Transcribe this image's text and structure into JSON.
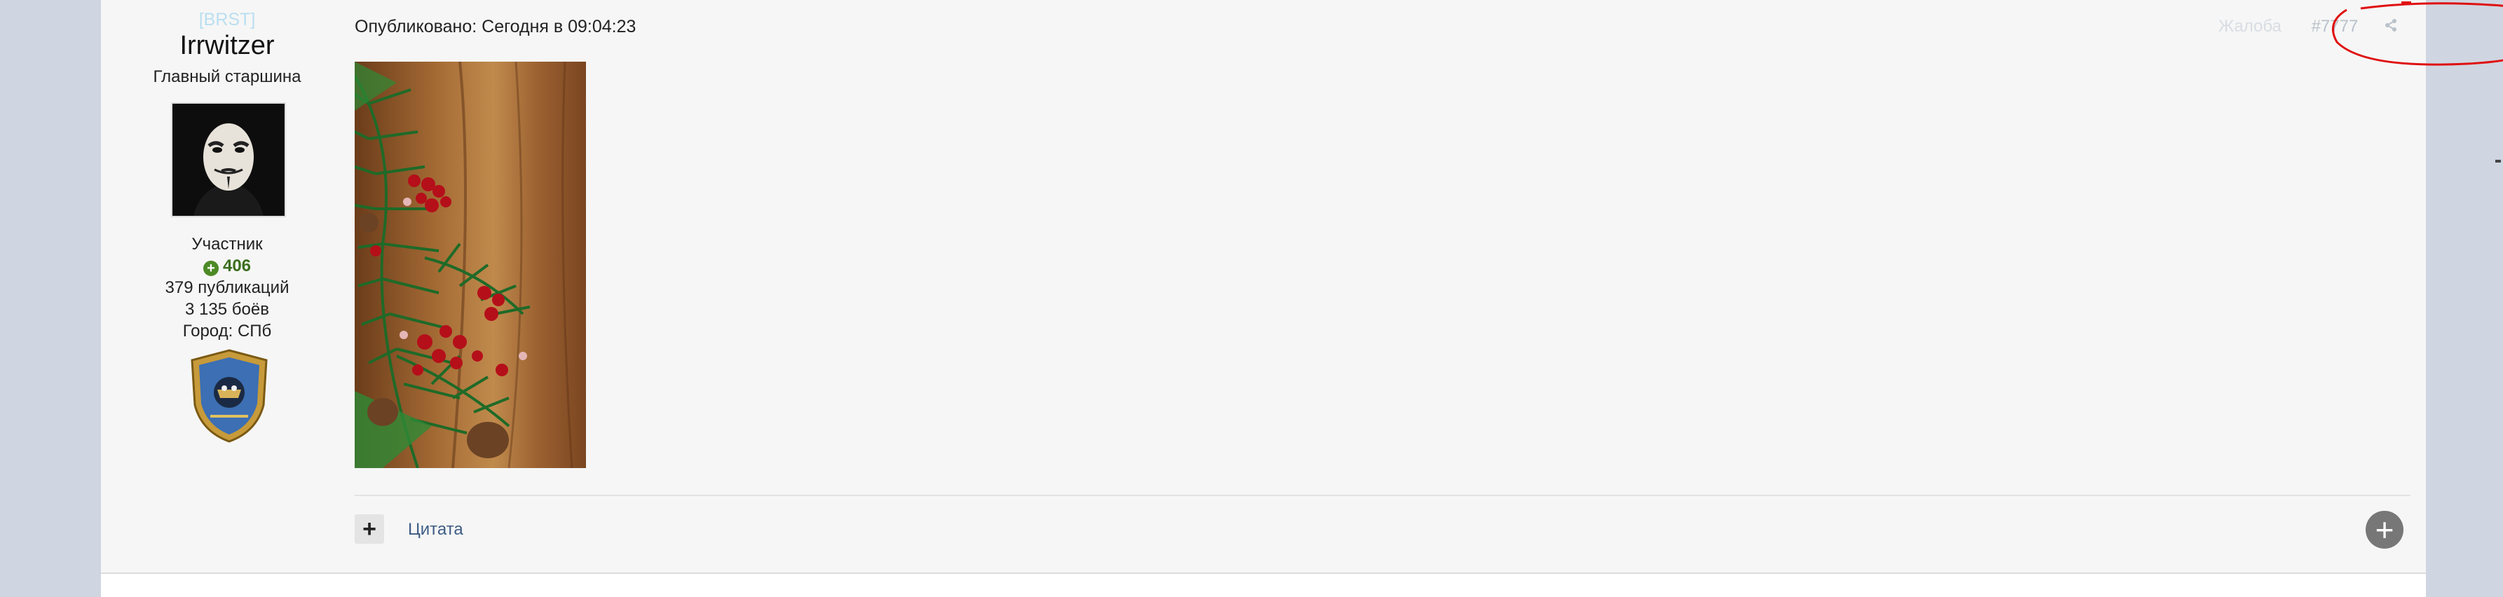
{
  "author": {
    "clan": "[BRST]",
    "username": "Irrwitzer",
    "rank": "Главный старшина",
    "role": "Участник",
    "reputation": "406",
    "posts": "379 публикаций",
    "battles": "3 135 боёв",
    "city": "Город: СПб"
  },
  "post": {
    "published": "Опубликовано: Сегодня в 09:04:23",
    "report": "Жалоба",
    "number": "#7777",
    "quote_label": "Цитата",
    "add_label": "+",
    "plus_label": "+"
  },
  "icons": {
    "share": "share-icon",
    "reputation": "plus-circle-icon",
    "multiquote": "plus-icon",
    "add_reaction": "plus-circle-icon"
  },
  "colors": {
    "page_bg": "#cfd6e1",
    "post_bg": "#f6f6f6",
    "reputation": "#3b6e1e",
    "link": "#3d5c85",
    "annotation": "#e01010"
  }
}
